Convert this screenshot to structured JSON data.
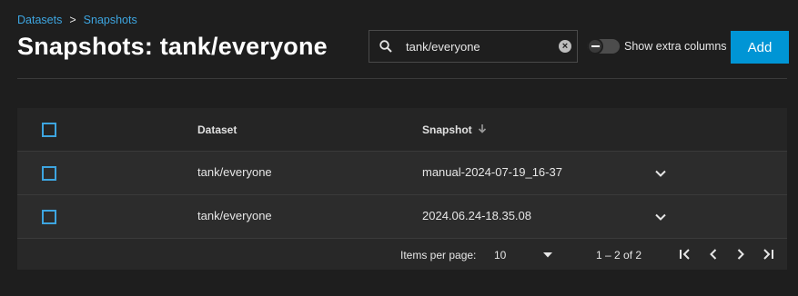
{
  "breadcrumb": {
    "items": [
      "Datasets",
      "Snapshots"
    ],
    "separator": ">"
  },
  "page_title": "Snapshots: tank/everyone",
  "search": {
    "value": "tank/everyone"
  },
  "toggle": {
    "label": "Show extra columns",
    "on": false
  },
  "add_button": {
    "label": "Add"
  },
  "table": {
    "columns": [
      "Dataset",
      "Snapshot"
    ],
    "sort": {
      "column": "Snapshot",
      "direction": "descending"
    },
    "rows": [
      {
        "dataset": "tank/everyone",
        "snapshot": "manual-2024-07-19_16-37"
      },
      {
        "dataset": "tank/everyone",
        "snapshot": "2024.06.24-18.35.08"
      }
    ]
  },
  "pagination": {
    "items_per_page_label": "Items per page:",
    "items_per_page": "10",
    "range": "1 – 2 of 2"
  },
  "colors": {
    "accent": "#0095d5",
    "link": "#3da5e0",
    "background": "#1e1e1e"
  },
  "icons": [
    "search-icon",
    "clear-icon",
    "sort-arrow-icon",
    "chevron-down-icon",
    "dropdown-arrow-icon",
    "first-page-icon",
    "previous-page-icon",
    "next-page-icon",
    "last-page-icon"
  ]
}
